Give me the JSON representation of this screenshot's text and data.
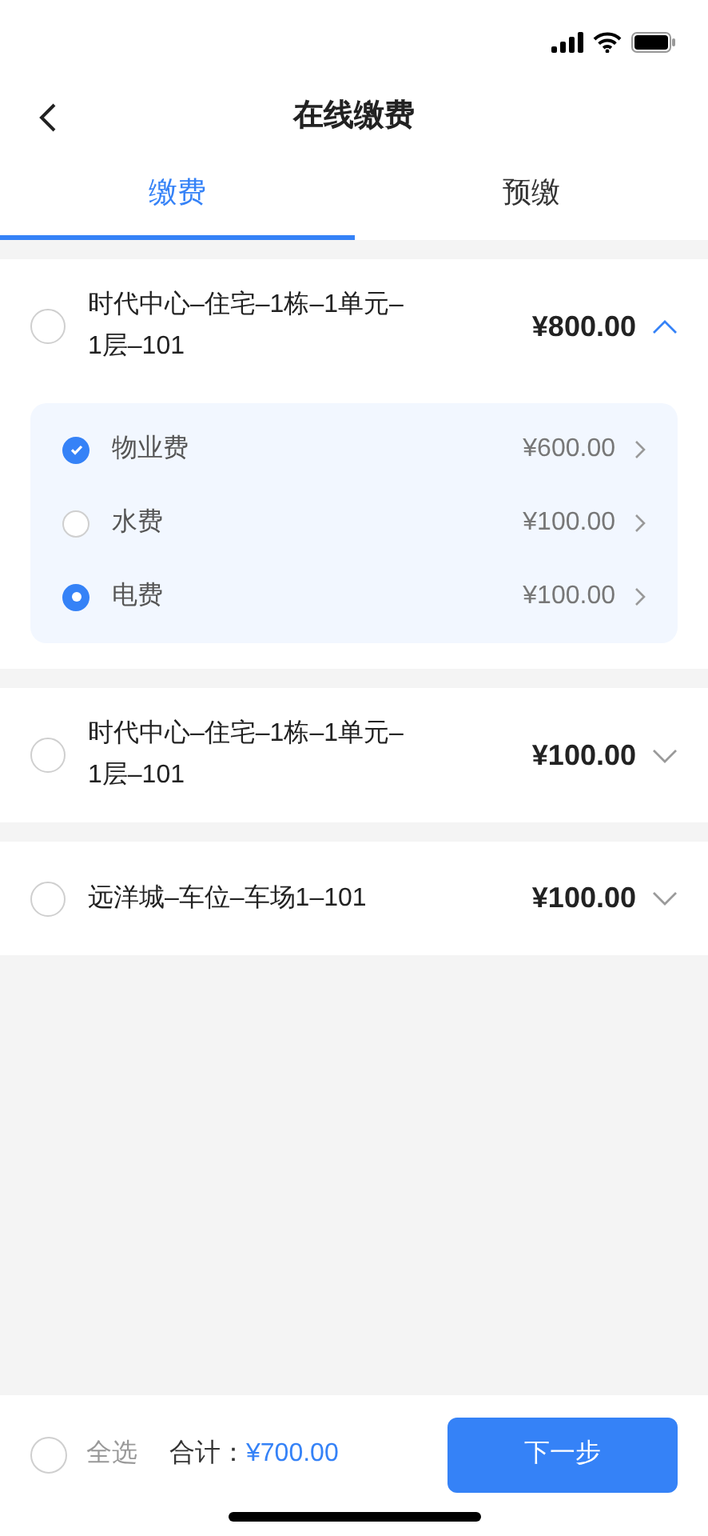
{
  "nav": {
    "title": "在线缴费"
  },
  "tabs": [
    {
      "label": "缴费",
      "selected": true
    },
    {
      "label": "预缴",
      "selected": false
    }
  ],
  "bills": [
    {
      "name": "时代中心–住宅–1栋–1单元–1层–101",
      "amount": "¥800.00",
      "checked": false,
      "expanded": true,
      "items": [
        {
          "kind": "checkbox",
          "label": "物业费",
          "amount": "¥600.00",
          "checked": true
        },
        {
          "kind": "radio",
          "label": "水费",
          "amount": "¥100.00",
          "checked": false
        },
        {
          "kind": "radio",
          "label": "电费",
          "amount": "¥100.00",
          "checked": true
        }
      ]
    },
    {
      "name": "时代中心–住宅–1栋–1单元–1层–101",
      "amount": "¥100.00",
      "checked": false,
      "expanded": false
    },
    {
      "name": "远洋城–车位–车场1–101",
      "amount": "¥100.00",
      "checked": false,
      "expanded": false
    }
  ],
  "footer": {
    "select_all": {
      "label": "全选",
      "checked": false
    },
    "total_label": "合计：",
    "total": "¥700.00",
    "next_button": "下一步"
  }
}
